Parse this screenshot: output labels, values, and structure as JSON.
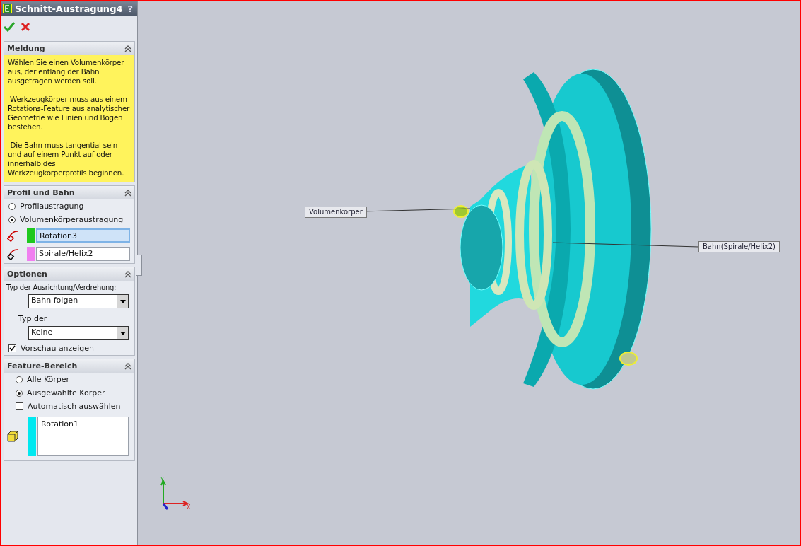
{
  "window": {
    "title": "Schnitt-Austragung4",
    "help": "?"
  },
  "message": {
    "title": "Meldung",
    "paragraphs": [
      "Wählen Sie einen Volumenkörper aus, der entlang der Bahn ausgetragen werden soll.",
      "-Werkzeugkörper muss aus einem Rotations-Feature aus analytischer Geometrie wie Linien und Bogen bestehen.",
      "-Die Bahn muss tangential sein und auf einem Punkt auf oder innerhalb des Werkzeugkörperprofils beginnen."
    ]
  },
  "profile": {
    "title": "Profil und Bahn",
    "options": [
      {
        "label": "Profilaustragung",
        "selected": false
      },
      {
        "label": "Volumenkörperaustragung",
        "selected": true
      }
    ],
    "selections": [
      {
        "value": "Rotation3",
        "color": "#1ec81e",
        "selected": true
      },
      {
        "value": "Spirale/Helix2",
        "color": "#f07ff0",
        "selected": false
      }
    ]
  },
  "options": {
    "title": "Optionen",
    "fields": [
      {
        "label": "Typ der Ausrichtung/Verdrehung:",
        "value": "Bahn folgen"
      },
      {
        "label": "Typ der",
        "value": "Keine"
      }
    ],
    "preview": {
      "label": "Vorschau anzeigen",
      "checked": true
    }
  },
  "scope": {
    "title": "Feature-Bereich",
    "options": [
      {
        "label": "Alle Körper",
        "selected": false
      },
      {
        "label": "Ausgewählte Körper",
        "selected": true
      }
    ],
    "auto": {
      "label": "Automatisch auswählen",
      "checked": false
    },
    "bodies": {
      "color": "#00e8f0",
      "items": [
        "Rotation1"
      ]
    }
  },
  "triad": {
    "y": "Y",
    "x": "X"
  },
  "callouts": [
    {
      "label": "Volumenkörper"
    },
    {
      "label": "Bahn(Spirale/Helix2)"
    }
  ]
}
